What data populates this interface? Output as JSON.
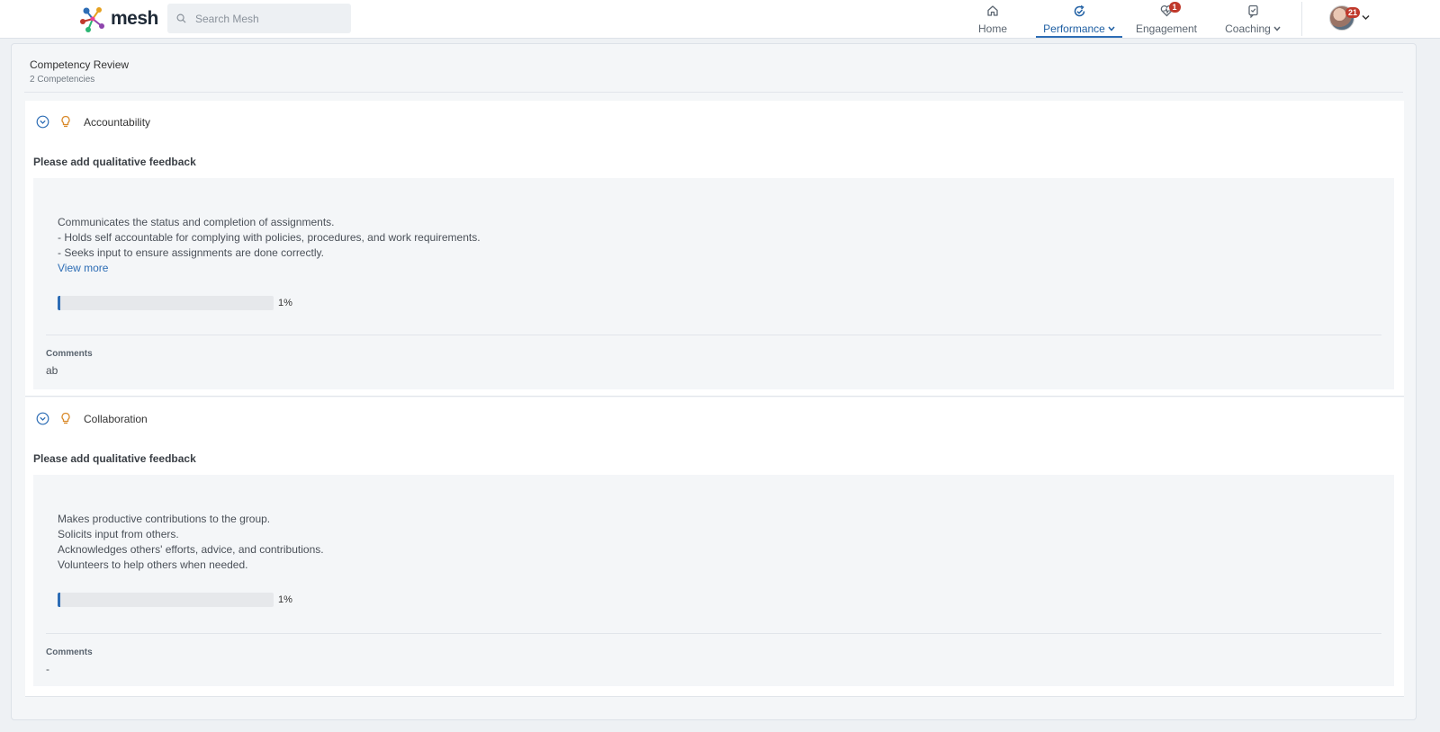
{
  "app": {
    "logo_text": "mesh",
    "search_placeholder": "Search Mesh"
  },
  "nav": {
    "home": {
      "label": "Home",
      "icon": "home-icon"
    },
    "performance": {
      "label": "Performance",
      "icon": "performance-icon"
    },
    "engagement": {
      "label": "Engagement",
      "icon": "heartbeat-icon",
      "badge": "1"
    },
    "coaching": {
      "label": "Coaching",
      "icon": "coaching-icon"
    },
    "avatar_badge": "21"
  },
  "review": {
    "title": "Competency Review",
    "subtitle": "2 Competencies"
  },
  "competencies": [
    {
      "name": "Accountability",
      "prompt": "Please add qualitative feedback",
      "description": [
        "Communicates the status and completion of assignments.",
        "- Holds self accountable for complying with policies, procedures, and work requirements.",
        "- Seeks input to ensure assignments are done correctly."
      ],
      "view_more": "View more",
      "progress_label": "1%",
      "progress_value": 1,
      "comments_label": "Comments",
      "comments_value": "ab"
    },
    {
      "name": "Collaboration",
      "prompt": "Please add qualitative feedback",
      "description": [
        "Makes productive contributions to the group.",
        "Solicits input from others.",
        "Acknowledges others' efforts, advice, and contributions.",
        "Volunteers to help others when needed."
      ],
      "progress_label": "1%",
      "progress_value": 1,
      "comments_label": "Comments",
      "comments_value": "-"
    }
  ],
  "colors": {
    "accent": "#2d6db5",
    "badge": "#c0392b",
    "icon_orange": "#d98a2b"
  }
}
